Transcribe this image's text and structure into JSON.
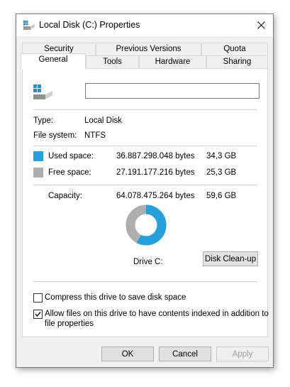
{
  "window": {
    "title": "Local Disk (C:) Properties"
  },
  "tabs": {
    "row1": [
      "Security",
      "Previous Versions",
      "Quota"
    ],
    "row2": [
      "General",
      "Tools",
      "Hardware",
      "Sharing"
    ],
    "active": "General"
  },
  "general": {
    "name_value": "",
    "type_label": "Type:",
    "type_value": "Local Disk",
    "fs_label": "File system:",
    "fs_value": "NTFS",
    "used_label": "Used space:",
    "used_bytes": "36.887.298.048 bytes",
    "used_gb": "34,3 GB",
    "free_label": "Free space:",
    "free_bytes": "27.191.177.216 bytes",
    "free_gb": "25,3 GB",
    "capacity_label": "Capacity:",
    "capacity_bytes": "64.078.475.264 bytes",
    "capacity_gb": "59,6 GB",
    "drive_label": "Drive C:",
    "cleanup_label": "Disk Clean-up",
    "used_fraction": 0.5757,
    "compress_label": "Compress this drive to save disk space",
    "compress_checked": false,
    "index_label_line1": "Allow files on this drive to have contents indexed in addition to",
    "index_label_line2": "file properties",
    "index_checked": true
  },
  "colors": {
    "used": "#26a0da",
    "free": "#aeaeae"
  },
  "buttons": {
    "ok": "OK",
    "cancel": "Cancel",
    "apply": "Apply"
  }
}
